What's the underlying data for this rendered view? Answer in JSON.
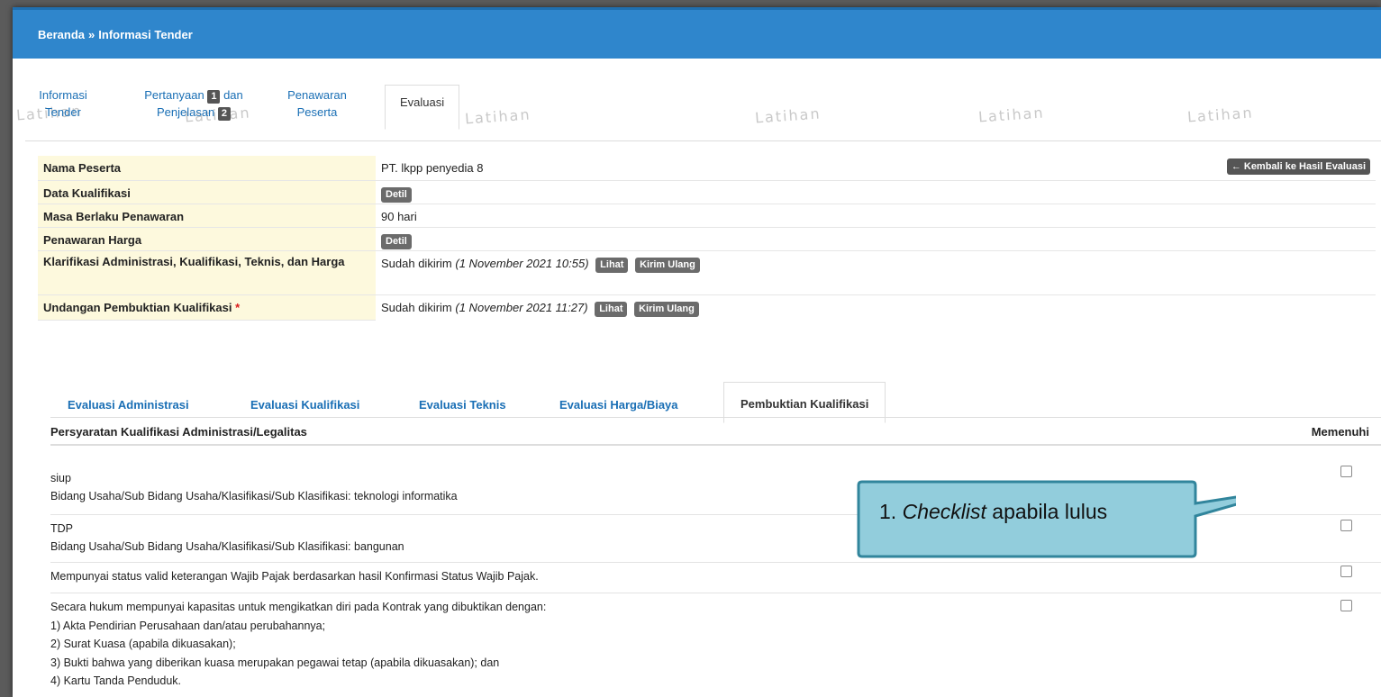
{
  "breadcrumb": {
    "home": "Beranda",
    "separator": "»",
    "current": "Informasi Tender"
  },
  "watermark": "Latihan",
  "tabs": {
    "info_line1": "Informasi",
    "info_line2": "Tender",
    "tanya_line1": "Pertanyaan",
    "tanya_count": "1",
    "tanya_dan": "dan",
    "tanya_line2": "Penjelasan",
    "tanya_count2": "2",
    "penawaran_line1": "Penawaran",
    "penawaran_line2": "Peserta",
    "evaluasi": "Evaluasi"
  },
  "info": {
    "back_button": "← Kembali ke Hasil Evaluasi",
    "nama_label": "Nama Peserta",
    "nama_value": "PT. lkpp penyedia 8",
    "kualifikasi_label": "Data Kualifikasi",
    "detil": "Detil",
    "masa_label": "Masa Berlaku Penawaran",
    "masa_value": "90 hari",
    "harga_label": "Penawaran Harga",
    "klarifikasi_label": "Klarifikasi Administrasi, Kualifikasi, Teknis, dan Harga",
    "sent_prefix": "Sudah dikirim",
    "klarifikasi_date": "(1 November 2021 10:55)",
    "undangan_label": "Undangan Pembuktian Kualifikasi",
    "required_mark": "*",
    "undangan_date": "(1 November 2021 11:27)",
    "lihat": "Lihat",
    "kirim_ulang": "Kirim Ulang"
  },
  "eval_tabs": [
    "Evaluasi Administrasi",
    "Evaluasi Kualifikasi",
    "Evaluasi Teknis",
    "Evaluasi Harga/Biaya",
    "Pembuktian Kualifikasi"
  ],
  "requirements": {
    "header": "Persyaratan Kualifikasi Administrasi/Legalitas",
    "header_check": "Memenuhi",
    "rows": [
      {
        "line1": "siup",
        "line2": "Bidang Usaha/Sub Bidang Usaha/Klasifikasi/Sub Klasifikasi: teknologi informatika"
      },
      {
        "line1": "TDP",
        "line2": "Bidang Usaha/Sub Bidang Usaha/Klasifikasi/Sub Klasifikasi: bangunan"
      },
      {
        "line1": "Mempunyai status valid keterangan Wajib Pajak berdasarkan hasil Konfirmasi Status Wajib Pajak."
      },
      {
        "line1": "Secara hukum mempunyai kapasitas untuk mengikatkan diri pada Kontrak yang dibuktikan dengan:",
        "line2": "1) Akta Pendirian Perusahaan dan/atau perubahannya;",
        "line3": "2) Surat Kuasa (apabila dikuasakan);",
        "line4": "3) Bukti bahwa yang diberikan kuasa merupakan pegawai tetap (apabila dikuasakan); dan",
        "line5": "4) Kartu Tanda Penduduk."
      }
    ]
  },
  "callout": {
    "number": "1.",
    "italic": "Checklist",
    "rest": "apabila lulus"
  },
  "colors": {
    "topbar": "#2f86cc",
    "label_bg": "#fdf9dd",
    "link": "#1a6fb5",
    "callout_fill": "#92cddc",
    "callout_border": "#31859c"
  }
}
